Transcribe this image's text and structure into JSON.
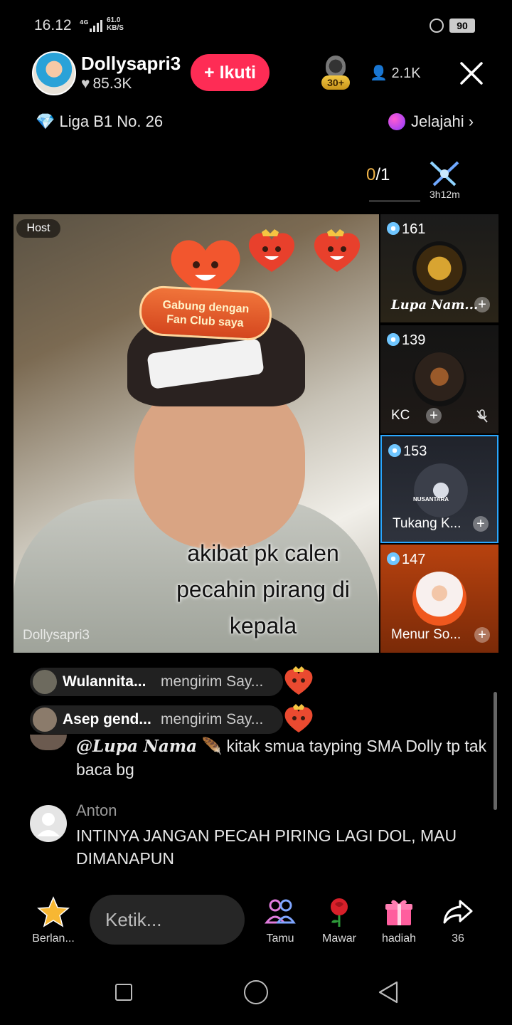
{
  "status_bar": {
    "time": "16.12",
    "network": "4G",
    "speed_value": "61.0",
    "speed_unit": "KB/S",
    "battery": "90"
  },
  "header": {
    "host_name": "Dollysapri3",
    "likes": "85.3K",
    "follow_label": "+ Ikuti",
    "rank_badge": "30+",
    "viewers": "2.1K",
    "league": "Liga B1 No. 26",
    "explore_label": "Jelajahi"
  },
  "battle": {
    "score_current": "0",
    "score_total": "/1",
    "timer": "3h12m"
  },
  "video": {
    "host_label": "Host",
    "fan_club_line1": "Gabung dengan",
    "fan_club_line2": "Fan Club saya",
    "caption_line1": "akibat pk calen",
    "caption_line2": "pecahin pirang di",
    "caption_line3": "kepala",
    "watermark": "Dollysapri3"
  },
  "guests": [
    {
      "score": "161",
      "name": "Lupa Nam...",
      "selected": false
    },
    {
      "score": "139",
      "name": "KC",
      "selected": false,
      "mic_muted": true
    },
    {
      "score": "153",
      "name": "Tukang K...",
      "selected": true,
      "avatar_text": "NUSANTARA"
    },
    {
      "score": "147",
      "name": "Menur So...",
      "selected": false
    }
  ],
  "gift_notifications": [
    {
      "user": "Wulannita...",
      "action": "mengirim Say..."
    },
    {
      "user": "Asep gend...",
      "action": "mengirim Say..."
    }
  ],
  "comments": [
    {
      "user": "@Lupa Nama",
      "text": "kitak smua tayping SMA Dolly tp tak baca bg"
    },
    {
      "user": "Anton",
      "text": "INTINYA JANGAN PECAH  PIRING LAGI DOL, MAU DIMANAPUN"
    }
  ],
  "bottom_bar": {
    "favorites_label": "Berlan...",
    "input_placeholder": "Ketik...",
    "guests_label": "Tamu",
    "rose_label": "Mawar",
    "gift_label": "hadiah",
    "share_count": "36"
  },
  "colors": {
    "follow": "#fe2c55",
    "score_highlight": "#f0b347",
    "selected_border": "#2aa7ff"
  }
}
